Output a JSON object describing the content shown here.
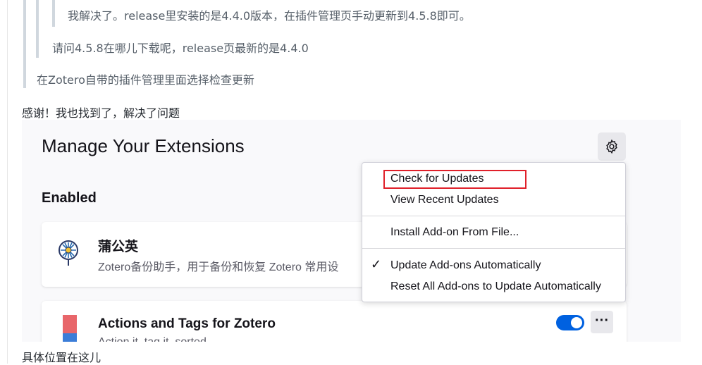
{
  "thread": {
    "quote_level3": "我解决了。release里安装的是4.4.0版本，在插件管理页手动更新到4.5.8即可。",
    "quote_level2": "请问4.5.8在哪儿下载呢，release页最新的是4.4.0",
    "quote_level1": "在Zotero自带的插件管理里面选择检查更新",
    "reply_text": "感谢！我也找到了，解决了问题",
    "caption": "具体位置在这儿"
  },
  "screenshot": {
    "page_title": "Manage Your Extensions",
    "section_label": "Enabled",
    "menu": {
      "items": [
        "Check for Updates",
        "View Recent Updates",
        "Install Add-on From File...",
        "Update Add-ons Automatically",
        "Reset All Add-ons to Update Automatically"
      ],
      "checked_item": "Update Add-ons Automatically",
      "highlighted_item": "Check for Updates"
    },
    "extensions": [
      {
        "name": "蒲公英",
        "description": "Zotero备份助手，用于备份和恢复 Zotero 常用设",
        "icon": "dandelion-icon"
      },
      {
        "name": "Actions and Tags for Zotero",
        "description": "Action it, tag it, sorted.",
        "icon": "bookmark-ribbon-icon",
        "enabled": true
      }
    ],
    "colors": {
      "accent": "#0061e0",
      "highlight_border": "#e0202a"
    }
  }
}
